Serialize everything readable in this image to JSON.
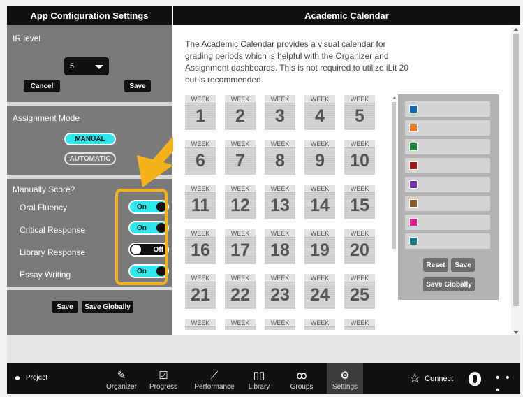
{
  "left_panel": {
    "title": "App Configuration Settings",
    "ir_level_label": "IR level",
    "ir_level_value": "5",
    "cancel_label": "Cancel",
    "save_label": "Save",
    "assignment_mode_label": "Assignment Mode",
    "modes": [
      {
        "label": "MANUAL",
        "selected": true
      },
      {
        "label": "AUTOMATIC",
        "selected": false
      }
    ],
    "manually_score_label": "Manually Score?",
    "scores": [
      {
        "label": "Oral Fluency",
        "state": "On",
        "on": true
      },
      {
        "label": "Critical Response",
        "state": "On",
        "on": true
      },
      {
        "label": "Library Response",
        "state": "Off",
        "on": false
      },
      {
        "label": "Essay Writing",
        "state": "On",
        "on": true
      }
    ],
    "bottom_save_label": "Save",
    "bottom_save_globally_label": "Save Globally"
  },
  "right_panel": {
    "title": "Academic Calendar",
    "description": "The Academic Calendar provides a visual calendar for grading periods which is helpful with the Organizer and Assignment dashboards. This is not required to utilize iLit 20 but is recommended.",
    "week_label": "WEEK",
    "weeks": [
      "1",
      "2",
      "3",
      "4",
      "5",
      "6",
      "7",
      "8",
      "9",
      "10",
      "11",
      "12",
      "13",
      "14",
      "15",
      "16",
      "17",
      "18",
      "19",
      "20",
      "21",
      "22",
      "23",
      "24",
      "25",
      "",
      "",
      "",
      "",
      ""
    ],
    "swatches": [
      "#1565c0",
      "#f07a28",
      "#1a8a3a",
      "#a31717",
      "#7b2fa6",
      "#8a5a2b",
      "#e91e8c",
      "#117a80"
    ],
    "reset_label": "Reset",
    "save_label": "Save",
    "save_globally_label": "Save Globally"
  },
  "nav": {
    "project_label": "Project",
    "items": [
      {
        "label": "Organizer",
        "icon": "edit-icon",
        "glyph": "✎"
      },
      {
        "label": "Progress",
        "icon": "checkbox-icon",
        "glyph": "☑"
      },
      {
        "label": "Performance",
        "icon": "chart-icon",
        "glyph": "⟋"
      },
      {
        "label": "Library",
        "icon": "book-icon",
        "glyph": "▯▯"
      },
      {
        "label": "Groups",
        "icon": "groups-icon",
        "glyph": "ꝏ"
      },
      {
        "label": "Settings",
        "icon": "gear-icon",
        "glyph": "⚙"
      }
    ],
    "connect_label": "Connect",
    "more_label": "• • •"
  },
  "colors": {
    "accent_cyan": "#2fe6ec",
    "highlight_orange": "#f5b21b",
    "panel_gray": "#7a7a7a"
  }
}
